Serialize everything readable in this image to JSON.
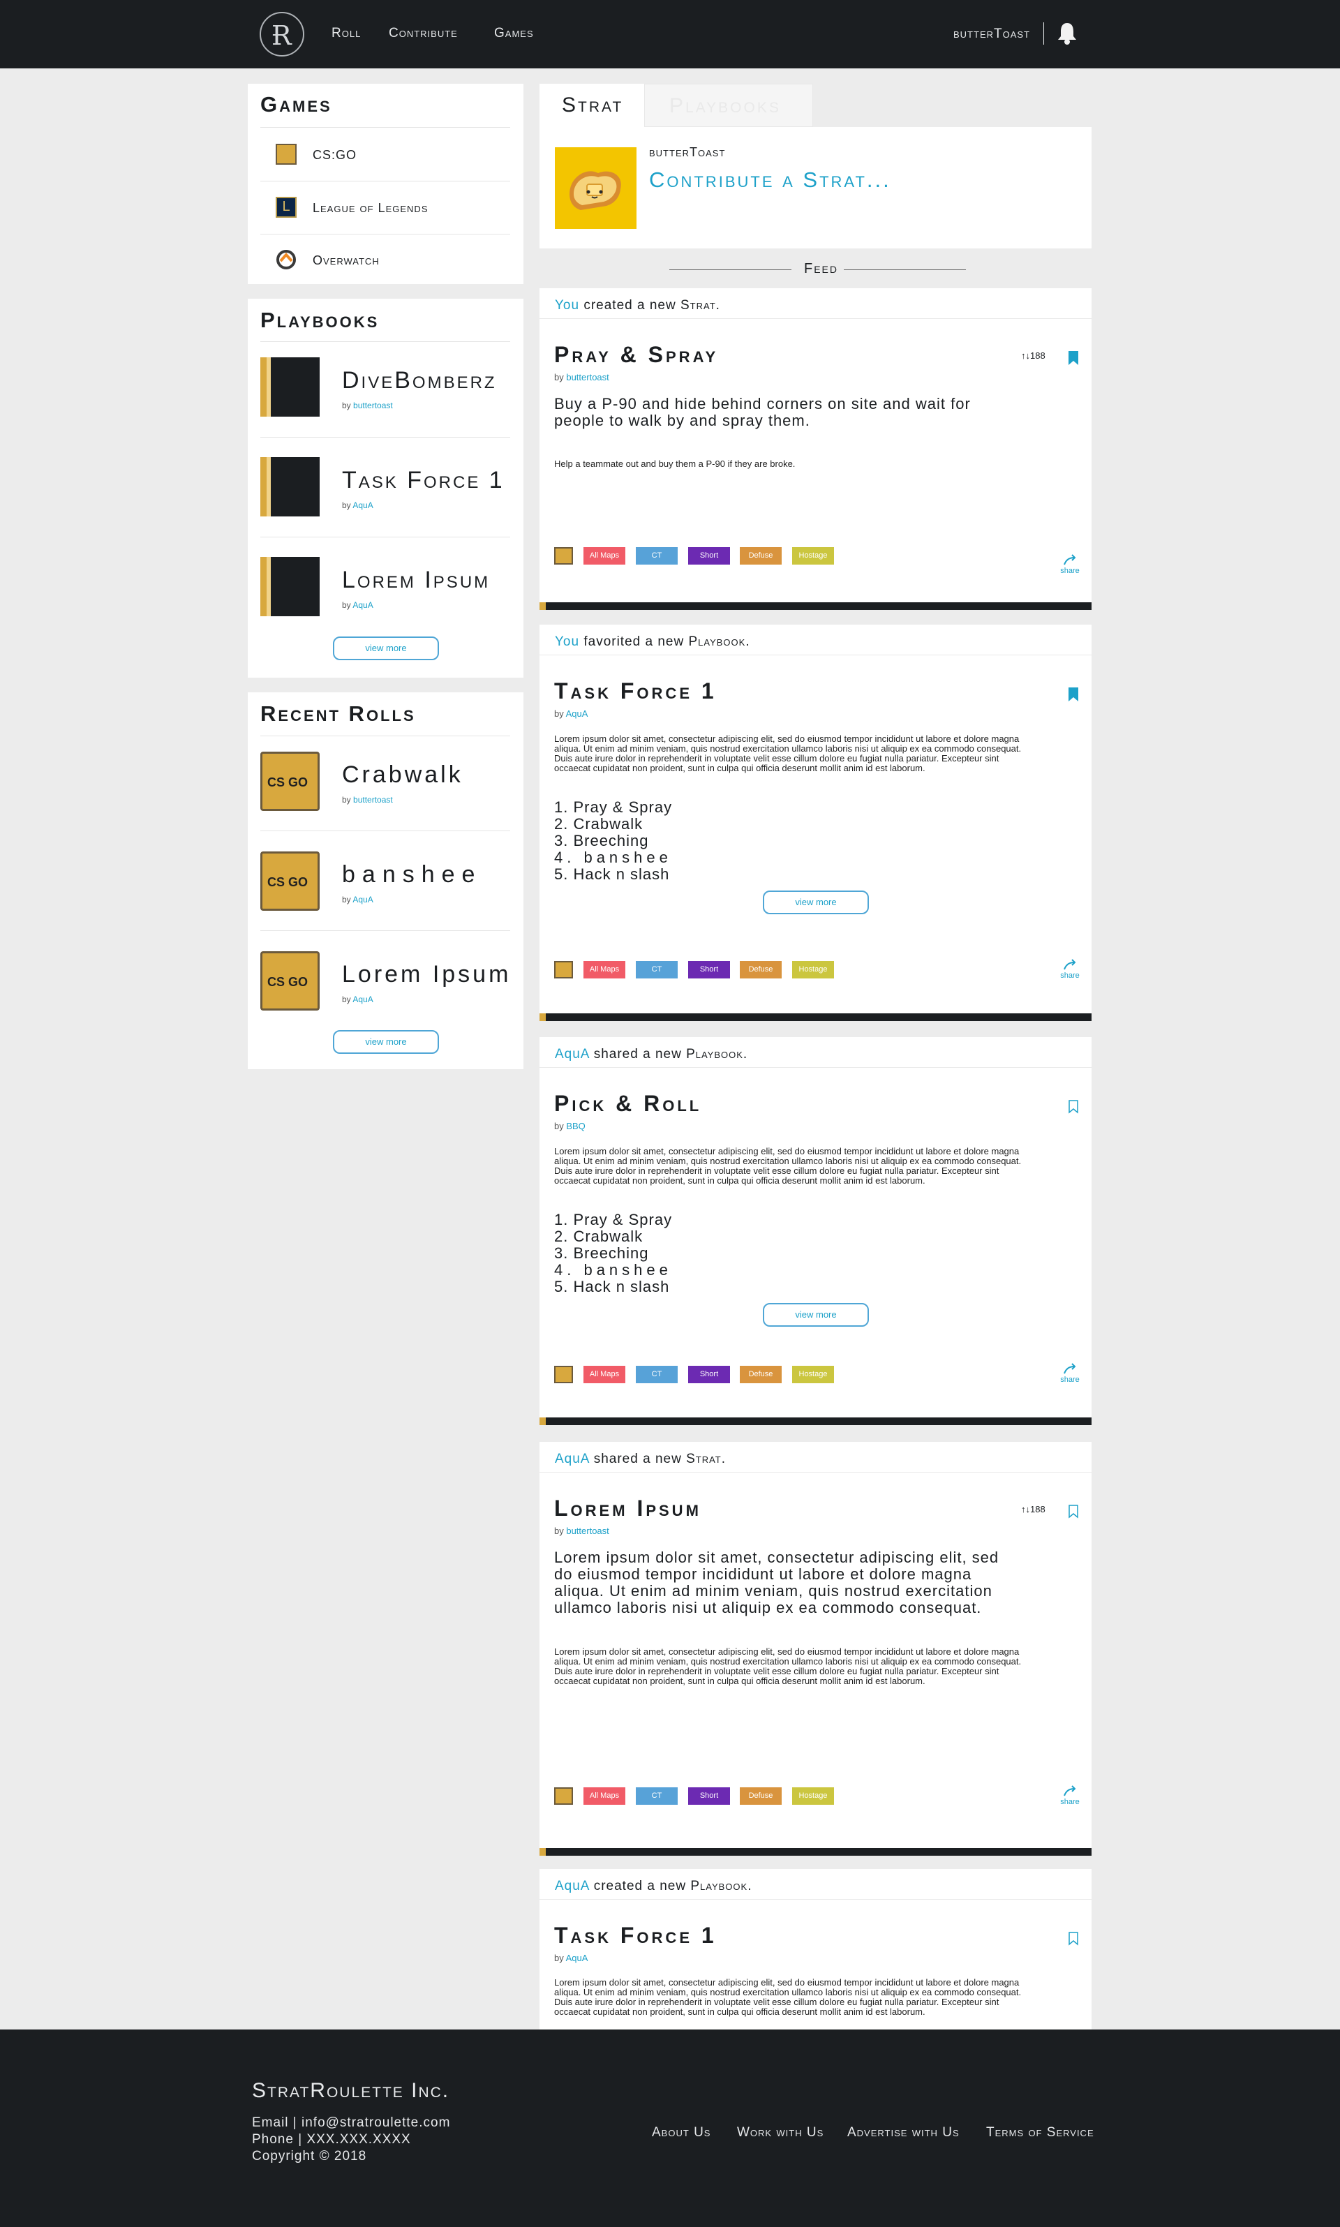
{
  "header": {
    "nav": [
      "Roll",
      "Contribute",
      "Games"
    ],
    "username": "butterToast"
  },
  "sidebar": {
    "games_title": "Games",
    "games": [
      "CS:GO",
      "League of Legends",
      "Overwatch"
    ],
    "playbooks_title": "Playbooks",
    "playbooks": [
      {
        "name": "DiveBomberz",
        "by": "by ",
        "author": "buttertoast"
      },
      {
        "name": "Task Force 1",
        "by": "by ",
        "author": "AquA"
      },
      {
        "name": "Lorem Ipsum",
        "by": "by ",
        "author": "AquA"
      }
    ],
    "view_more": "view more",
    "recent_title": "Recent Rolls",
    "rolls": [
      {
        "name": "Crabwalk",
        "by": "by ",
        "author": "buttertoast",
        "badge": "CS GO"
      },
      {
        "name": "banshee",
        "by": "by ",
        "author": "AquA",
        "badge": "CS GO"
      },
      {
        "name": "Lorem Ipsum",
        "by": "by ",
        "author": "AquA",
        "badge": "CS GO"
      }
    ]
  },
  "tabs": [
    "Strat",
    "Playbooks"
  ],
  "compose": {
    "user": "butterToast",
    "prompt": "Contribute a Strat..."
  },
  "feed_label": "Feed",
  "tags": [
    "All Maps",
    "CT",
    "Short",
    "Defuse",
    "Hostage"
  ],
  "tag_colors": [
    "#f15b67",
    "#57a2d8",
    "#6c2ab2",
    "#d9943e",
    "#cbc63f"
  ],
  "share_label": "share",
  "feed": [
    {
      "actor": "You",
      "verb": "created a new",
      "object": "Strat.",
      "title": "Pray & Spray",
      "by": "by ",
      "author": "buttertoast",
      "votes": "188",
      "lead": "Buy a P-90 and hide behind corners on site and wait for people to walk by and spray them.",
      "note": "Help a teammate out and buy them a P-90 if they are broke."
    },
    {
      "actor": "You",
      "verb": "favorited a new",
      "object": "Playbook.",
      "title": "Task Force 1",
      "by": "by ",
      "author": "AquA",
      "desc": "Lorem ipsum dolor sit amet, consectetur adipiscing elit, sed do eiusmod tempor incididunt ut labore et dolore magna aliqua. Ut enim ad minim veniam, quis nostrud exercitation ullamco laboris nisi ut aliquip ex ea commodo consequat. Duis aute irure dolor in reprehenderit in voluptate velit esse cillum dolore eu fugiat nulla pariatur. Excepteur sint occaecat cupidatat non proident, sunt in culpa qui officia deserunt mollit anim id est laborum.",
      "plays": [
        "1. Pray & Spray",
        "2. Crabwalk",
        "3. Breeching",
        "4. banshee",
        "5. Hack n slash"
      ],
      "view_more": "view more"
    },
    {
      "actor": "AquA",
      "verb": "shared a new",
      "object": "Playbook.",
      "title": "Pick & Roll",
      "by": "by ",
      "author": "BBQ",
      "desc": "Lorem ipsum dolor sit amet, consectetur adipiscing elit, sed do eiusmod tempor incididunt ut labore et dolore magna aliqua. Ut enim ad minim veniam, quis nostrud exercitation ullamco laboris nisi ut aliquip ex ea commodo consequat. Duis aute irure dolor in reprehenderit in voluptate velit esse cillum dolore eu fugiat nulla pariatur. Excepteur sint occaecat cupidatat non proident, sunt in culpa qui officia deserunt mollit anim id est laborum.",
      "plays": [
        "1. Pray & Spray",
        "2. Crabwalk",
        "3. Breeching",
        "4. banshee",
        "5. Hack n slash"
      ],
      "view_more": "view more"
    },
    {
      "actor": "AquA",
      "verb": "shared a new",
      "object": "Strat.",
      "title": "Lorem Ipsum",
      "by": "by ",
      "author": "buttertoast",
      "votes": "188",
      "lead": "Lorem ipsum dolor sit amet, consectetur adipiscing elit, sed do eiusmod tempor incididunt ut labore et dolore magna aliqua. Ut enim ad minim veniam, quis nostrud exercitation ullamco laboris nisi ut aliquip ex ea commodo consequat.",
      "note": "Lorem ipsum dolor sit amet, consectetur adipiscing elit, sed do eiusmod tempor incididunt ut labore et dolore magna aliqua. Ut enim ad minim veniam, quis nostrud exercitation ullamco laboris nisi ut aliquip ex ea commodo consequat. Duis aute irure dolor in reprehenderit in voluptate velit esse cillum dolore eu fugiat nulla pariatur. Excepteur sint occaecat cupidatat non proident, sunt in culpa qui officia deserunt mollit anim id est laborum."
    },
    {
      "actor": "AquA",
      "verb": "created a new",
      "object": "Playbook.",
      "title": "Task Force 1",
      "by": "by ",
      "author": "AquA",
      "desc": "Lorem ipsum dolor sit amet, consectetur adipiscing elit, sed do eiusmod tempor incididunt ut labore et dolore magna aliqua. Ut enim ad minim veniam, quis nostrud exercitation ullamco laboris nisi ut aliquip ex ea commodo consequat. Duis aute irure dolor in reprehenderit in voluptate velit esse cillum dolore eu fugiat nulla pariatur. Excepteur sint occaecat cupidatat non proident, sunt in culpa qui officia deserunt mollit anim id est laborum."
    }
  ],
  "footer": {
    "brand": "StratRoulette Inc.",
    "email": "Email | info@stratroulette.com",
    "phone": "Phone | XXX.XXX.XXXX",
    "copyright": "Copyright © 2018",
    "links": [
      "About Us",
      "Work with Us",
      "Advertise with Us",
      "Terms of Service"
    ]
  }
}
